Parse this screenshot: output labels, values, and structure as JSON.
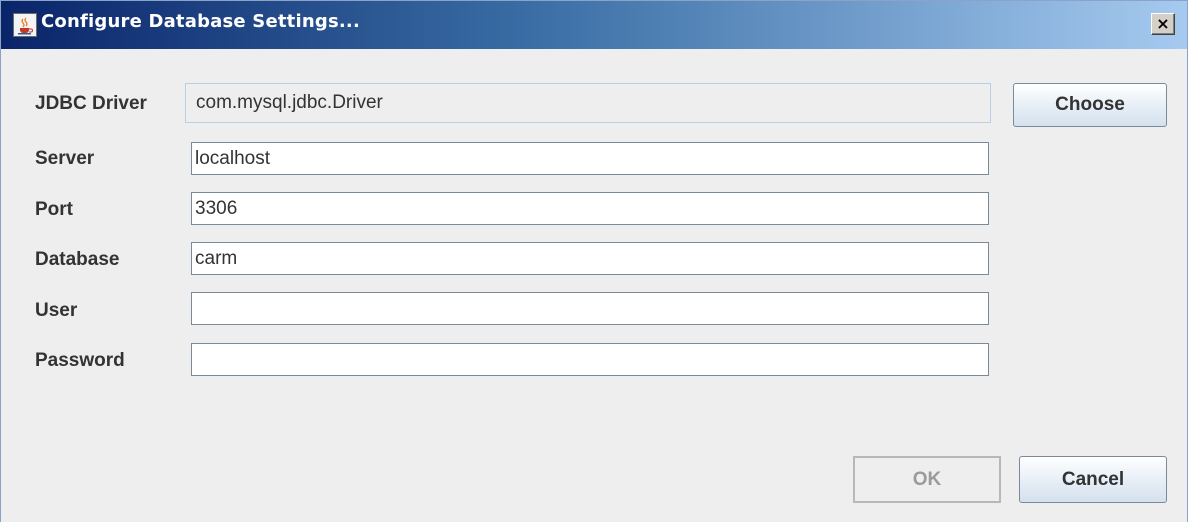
{
  "window": {
    "title": "Configure Database Settings...",
    "icon": "java-coffee-cup-icon",
    "close_label": "×"
  },
  "form": {
    "jdbc_driver": {
      "label": "JDBC Driver",
      "value": "com.mysql.jdbc.Driver"
    },
    "server": {
      "label": "Server",
      "value": "localhost"
    },
    "port": {
      "label": "Port",
      "value": "3306"
    },
    "database": {
      "label": "Database",
      "value": "carm"
    },
    "user": {
      "label": "User",
      "value": ""
    },
    "password": {
      "label": "Password",
      "value": ""
    }
  },
  "buttons": {
    "choose": "Choose",
    "ok": "OK",
    "cancel": "Cancel"
  },
  "colors": {
    "title_gradient_start": "#0a246a",
    "title_gradient_end": "#a6caf0",
    "dialog_background": "#eeeeee"
  }
}
